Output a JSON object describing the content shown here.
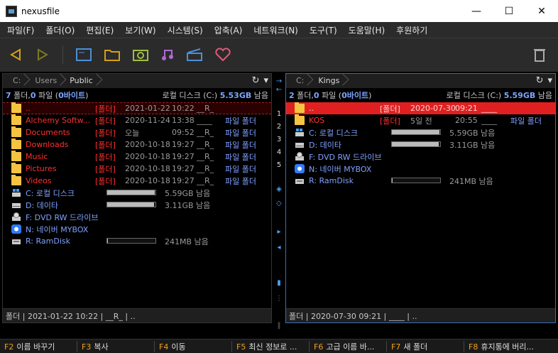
{
  "window": {
    "title": "nexusfile",
    "minimize": "—",
    "maximize": "☐",
    "close": "✕"
  },
  "menu": [
    "파일(F)",
    "폴더(O)",
    "편집(E)",
    "보기(W)",
    "시스템(S)",
    "압축(A)",
    "네트워크(N)",
    "도구(T)",
    "도움말(H)",
    "후원하기"
  ],
  "toolbar": {
    "icons": [
      "back-arrow-icon",
      "forward-arrow-icon",
      "console-icon",
      "folder-icon",
      "photo-icon",
      "music-icon",
      "video-icon",
      "heart-icon",
      "trash-icon"
    ],
    "colors": {
      "back": "#d4a017",
      "forward": "#6b6b1a",
      "blue": "#4a90d9",
      "green": "#a0c040",
      "purple": "#b06ad4",
      "heart": "#e05a7a"
    }
  },
  "left": {
    "path": [
      "C:",
      "Users",
      "Public"
    ],
    "summary": {
      "folders": "7",
      "folders_label": "폴더, ",
      "files": "0",
      "files_label": "파일 (",
      "bytes": "0바이트",
      "bytes_suffix": ")"
    },
    "disk": {
      "label": "로컬 디스크 (C:)",
      "free": "5.53GB",
      "suffix": "남음"
    },
    "rows": [
      {
        "name": "..",
        "type": "[폴더]",
        "date": "2021-01-22",
        "time": "10:22",
        "attr": "__R_",
        "kind": ""
      },
      {
        "name": "Alchemy Softw...",
        "type": "[폴더]",
        "date": "2020-11-24",
        "time": "13:38",
        "attr": "____",
        "kind": "파일 폴더"
      },
      {
        "name": "Documents",
        "type": "[폴더]",
        "date": "오늘",
        "time": "09:52",
        "attr": "__R_",
        "kind": "파일 폴더"
      },
      {
        "name": "Downloads",
        "type": "[폴더]",
        "date": "2020-10-18",
        "time": "19:27",
        "attr": "__R_",
        "kind": "파일 폴더"
      },
      {
        "name": "Music",
        "type": "[폴더]",
        "date": "2020-10-18",
        "time": "19:27",
        "attr": "__R_",
        "kind": "파일 폴더"
      },
      {
        "name": "Pictures",
        "type": "[폴더]",
        "date": "2020-10-18",
        "time": "19:27",
        "attr": "__R_",
        "kind": "파일 폴더"
      },
      {
        "name": "Videos",
        "type": "[폴더]",
        "date": "2020-10-18",
        "time": "19:27",
        "attr": "__R_",
        "kind": "파일 폴더"
      }
    ],
    "drives": [
      {
        "name": "C: 로컬 디스크",
        "free": "5.59GB 남음",
        "fill": 0.98,
        "icon": "windows-drive-icon"
      },
      {
        "name": "D: 데이타",
        "free": "3.11GB 남음",
        "fill": 0.97,
        "icon": "hard-drive-icon"
      },
      {
        "name": "F: DVD RW 드라이브",
        "free": "",
        "fill": null,
        "icon": "dvd-drive-icon"
      },
      {
        "name": "N: 네이버 MYBOX",
        "free": "",
        "fill": null,
        "icon": "cloud-drive-icon"
      },
      {
        "name": "R: RamDisk",
        "free": "241MB 남음",
        "fill": 0.02,
        "icon": "ram-drive-icon"
      }
    ],
    "status": "폴더  |  2021-01-22 10:22  |  __R_  |  .."
  },
  "right": {
    "path": [
      "C:",
      "Kings"
    ],
    "summary": {
      "folders": "2",
      "folders_label": "폴더, ",
      "files": "0",
      "files_label": "파일 (",
      "bytes": "0바이트",
      "bytes_suffix": ")"
    },
    "disk": {
      "label": "로컬 디스크 (C:)",
      "free": "5.59GB",
      "suffix": "남음"
    },
    "rows": [
      {
        "name": "..",
        "type": "[폴더]",
        "date": "2020-07-30",
        "time": "09:21",
        "attr": "____",
        "kind": ""
      },
      {
        "name": "KOS",
        "type": "[폴더]",
        "date": "5일 전",
        "time": "20:55",
        "attr": "____",
        "kind": "파일 폴더"
      }
    ],
    "drives": [
      {
        "name": "C: 로컬 디스크",
        "free": "5.59GB 남음",
        "fill": 0.98,
        "icon": "windows-drive-icon"
      },
      {
        "name": "D: 데이타",
        "free": "3.11GB 남음",
        "fill": 0.97,
        "icon": "hard-drive-icon"
      },
      {
        "name": "F: DVD RW 드라이브",
        "free": "",
        "fill": null,
        "icon": "dvd-drive-icon"
      },
      {
        "name": "N: 네이버 MYBOX",
        "free": "",
        "fill": null,
        "icon": "cloud-drive-icon"
      },
      {
        "name": "R: RamDisk",
        "free": "241MB 남음",
        "fill": 0.02,
        "icon": "ram-drive-icon"
      }
    ],
    "status": "폴더  |  2020-07-30 09:21  |  ____  |  .."
  },
  "middle": {
    "numbers": [
      "1",
      "2",
      "3",
      "4",
      "5"
    ]
  },
  "fkeys": [
    {
      "key": "F2",
      "label": "이름 바꾸기"
    },
    {
      "key": "F3",
      "label": "복사"
    },
    {
      "key": "F4",
      "label": "이동"
    },
    {
      "key": "F5",
      "label": "최신 정보로 ..."
    },
    {
      "key": "F6",
      "label": "고급 이름 바..."
    },
    {
      "key": "F7",
      "label": "새 폴더"
    },
    {
      "key": "F8",
      "label": "휴지통에 버리..."
    }
  ]
}
